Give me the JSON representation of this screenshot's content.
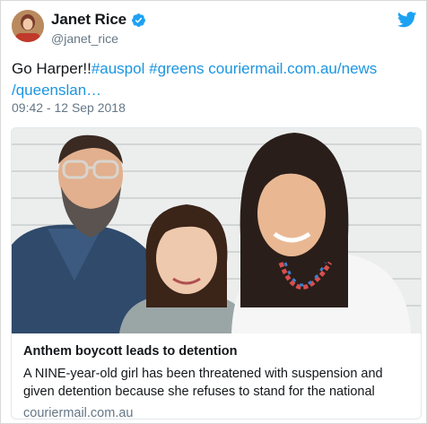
{
  "author": {
    "name": "Janet Rice",
    "handle": "@janet_rice",
    "verified": true
  },
  "tweet": {
    "prefix": "Go Harper!!",
    "hashtags": [
      "#auspol",
      "#greens"
    ],
    "link_line1": "couriermail.com.au/news",
    "link_line2": "/queenslan…",
    "timestamp": "09:42 - 12 Sep 2018"
  },
  "card": {
    "title": "Anthem boycott leads to detention",
    "description": "A NINE-year-old girl has been threatened with suspension and given detention because she refuses to stand for the national",
    "domain": "couriermail.com.au"
  },
  "icons": {
    "verified": "verified-badge-icon",
    "platform": "twitter-bird-icon"
  },
  "colors": {
    "link": "#1b95e0",
    "verified": "#1da1f2",
    "secondary_text": "#657786"
  }
}
